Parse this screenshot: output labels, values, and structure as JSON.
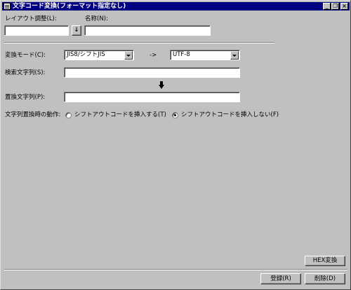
{
  "window": {
    "title": "文字コード変換(フォーマット指定なし)"
  },
  "titlebar_buttons": {
    "minimize": "_",
    "restore": "❐",
    "close": "×"
  },
  "layout": {
    "label": "レイアウト調整(L):",
    "value": "",
    "button_glyph": "↓"
  },
  "name": {
    "label": "名称(N):",
    "value": ""
  },
  "conversion": {
    "mode_label": "変換モード(C):",
    "from_value": "JIS8/シフトJIS",
    "arrow": "->",
    "to_value": "UTF-8"
  },
  "search": {
    "label": "検索文字列(S):",
    "value": ""
  },
  "replace": {
    "label": "置換文字列(P):",
    "value": ""
  },
  "behavior": {
    "label": "文字列置換時の動作:",
    "option_insert": "シフトアウトコードを挿入する(T)",
    "option_no_insert": "シフトアウトコードを挿入しない(F)",
    "selected": "no_insert"
  },
  "buttons": {
    "hex": "HEX変換",
    "register": "登録(R)",
    "delete": "削除(D)"
  }
}
